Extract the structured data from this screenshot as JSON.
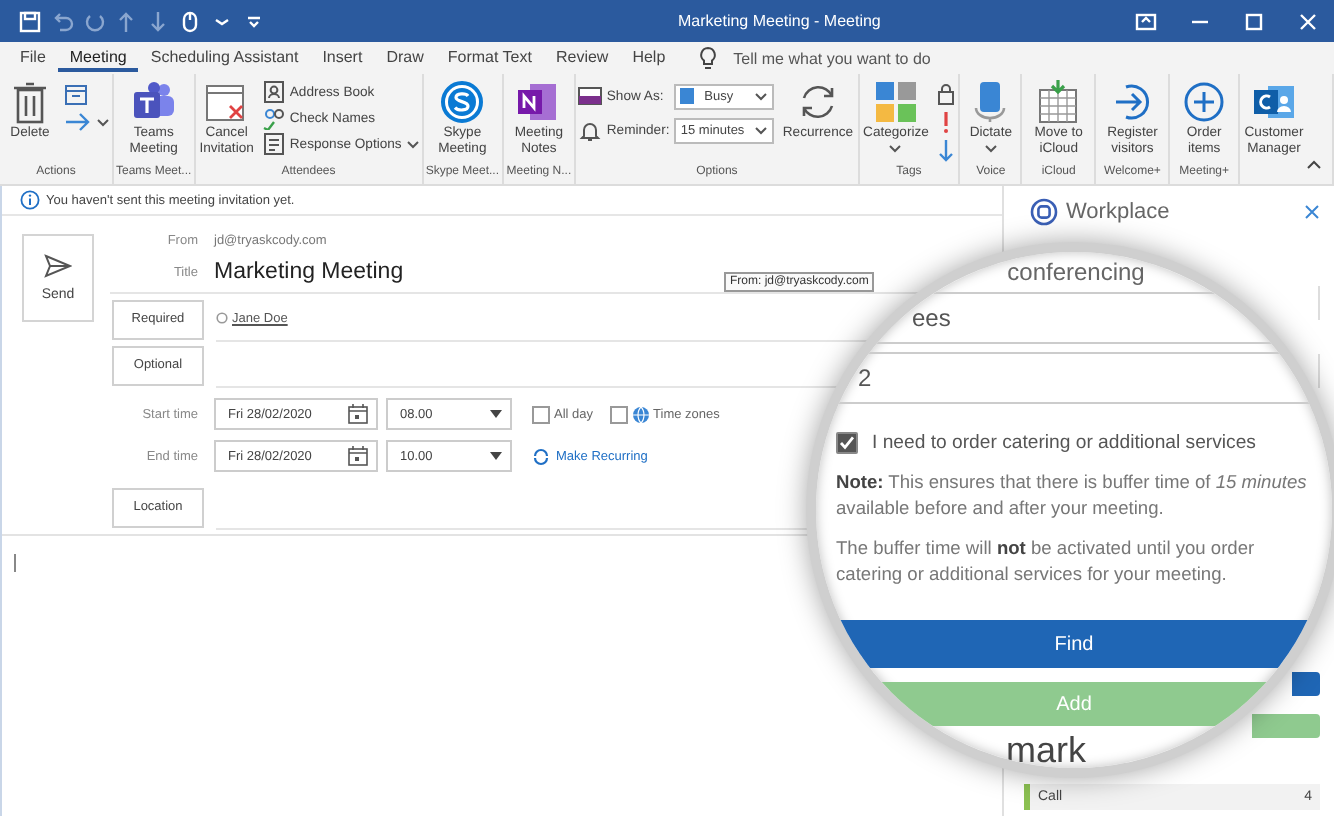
{
  "window": {
    "title": "Marketing Meeting  -  Meeting"
  },
  "menu_tabs": [
    {
      "label": "File",
      "selected": false
    },
    {
      "label": "Meeting",
      "selected": true
    },
    {
      "label": "Scheduling Assistant",
      "selected": false
    },
    {
      "label": "Insert",
      "selected": false
    },
    {
      "label": "Draw",
      "selected": false
    },
    {
      "label": "Format Text",
      "selected": false
    },
    {
      "label": "Review",
      "selected": false
    },
    {
      "label": "Help",
      "selected": false
    }
  ],
  "tell_me": "Tell me what you want to do",
  "ribbon": [
    {
      "label": "Actions",
      "columns": [
        [
          {
            "kind": "large",
            "label": "Delete"
          }
        ],
        [
          {
            "kind": "icon"
          },
          {
            "kind": "icon",
            "menu": true
          }
        ]
      ]
    },
    {
      "label": "Teams Meet...",
      "columns": [
        [
          {
            "kind": "large",
            "label": "Teams Meeting"
          }
        ]
      ]
    },
    {
      "label": "Attendees",
      "columns": [
        [
          {
            "kind": "large",
            "label": "Cancel Invitation"
          }
        ],
        [
          {
            "kind": "small",
            "label": "Address Book"
          },
          {
            "kind": "small",
            "label": "Check Names"
          },
          {
            "kind": "small",
            "label": "Response Options",
            "menu": true
          }
        ]
      ]
    },
    {
      "label": "Skype Meet...",
      "columns": [
        [
          {
            "kind": "large",
            "label": "Skype Meeting"
          }
        ]
      ]
    },
    {
      "label": "Meeting N...",
      "columns": [
        [
          {
            "kind": "large",
            "label": "Meeting Notes"
          }
        ]
      ]
    },
    {
      "label": "Options",
      "columns": [
        [
          {
            "kind": "select",
            "label": "Show As:",
            "value": "Busy"
          },
          {
            "kind": "select",
            "label": "Reminder:",
            "value": "15 minutes"
          }
        ],
        [
          {
            "kind": "large",
            "label": "Recurrence"
          }
        ]
      ]
    },
    {
      "label": "Tags",
      "columns": [
        [
          {
            "kind": "large",
            "label": "Categorize",
            "menu": true
          }
        ],
        [
          {
            "kind": "icon"
          },
          {
            "kind": "icon"
          },
          {
            "kind": "icon"
          }
        ]
      ]
    },
    {
      "label": "Voice",
      "columns": [
        [
          {
            "kind": "large",
            "label": "Dictate",
            "menu": true
          }
        ]
      ]
    },
    {
      "label": "iCloud",
      "columns": [
        [
          {
            "kind": "large",
            "label": "Move to iCloud"
          }
        ]
      ]
    },
    {
      "label": "Welcome+",
      "columns": [
        [
          {
            "kind": "large",
            "label": "Register visitors"
          }
        ]
      ]
    },
    {
      "label": "Meeting+",
      "columns": [
        [
          {
            "kind": "large",
            "label": "Order items"
          }
        ]
      ]
    },
    {
      "columns": [
        [
          {
            "kind": "large",
            "label": "Customer Manager"
          }
        ]
      ]
    }
  ],
  "info_bar": "You haven't sent this meeting invitation yet.",
  "form": {
    "send": "Send",
    "from_label": "From",
    "from": "jd@tryaskcody.com",
    "title_label": "Title",
    "title": "Marketing Meeting",
    "required": "Required",
    "attendees": [
      "Jane Doe"
    ],
    "optional": "Optional",
    "start_label": "Start time",
    "start_date": "Fri 28/02/2020",
    "start_time": "08.00",
    "end_label": "End time",
    "end_date": "Fri 28/02/2020",
    "end_time": "10.00",
    "options": [
      {
        "label": "All day",
        "checked": false
      },
      {
        "label": "Time zones",
        "checked": false
      }
    ],
    "recurring": "Make Recurring",
    "location": "Location"
  },
  "tooltip": "From: jd@tryaskcody.com",
  "side_pane": {
    "title": "Workplace",
    "list": [
      {
        "label": "Call",
        "count": "4"
      }
    ]
  },
  "magnifier": {
    "heading_top": "conferencing",
    "fields": [
      "ees",
      "2"
    ],
    "checkbox": {
      "label": "I need to order catering or additional services",
      "checked": true
    },
    "note": "**Note:** This ensures that there is buffer time of *15 minutes* available before and after your meeting.",
    "buffer": "The buffer time will **not** be activated until you order catering or additional services for your meeting.",
    "find": "Find",
    "add": "Add",
    "heading": "mark"
  }
}
